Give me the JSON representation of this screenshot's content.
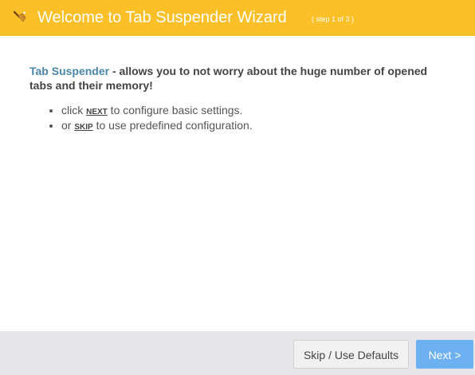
{
  "header": {
    "title": "Welcome to Tab Suspender Wizard",
    "step": "( step 1 of 3 )",
    "icon": "broom-icon",
    "background_color": "#fbbf27"
  },
  "intro": {
    "brand": "Tab Suspender",
    "text": " - allows you to not worry about the huge number of opened tabs and their memory!",
    "brand_color": "#4a86a8"
  },
  "bullets": [
    {
      "prefix": "click ",
      "keyword": "NEXT",
      "suffix": " to configure basic settings."
    },
    {
      "prefix": "or ",
      "keyword": "SKIP",
      "suffix": " to use predefined configuration."
    }
  ],
  "footer": {
    "skip_label": "Skip / Use Defaults",
    "next_label": "Next >",
    "next_color": "#6db1f2"
  }
}
